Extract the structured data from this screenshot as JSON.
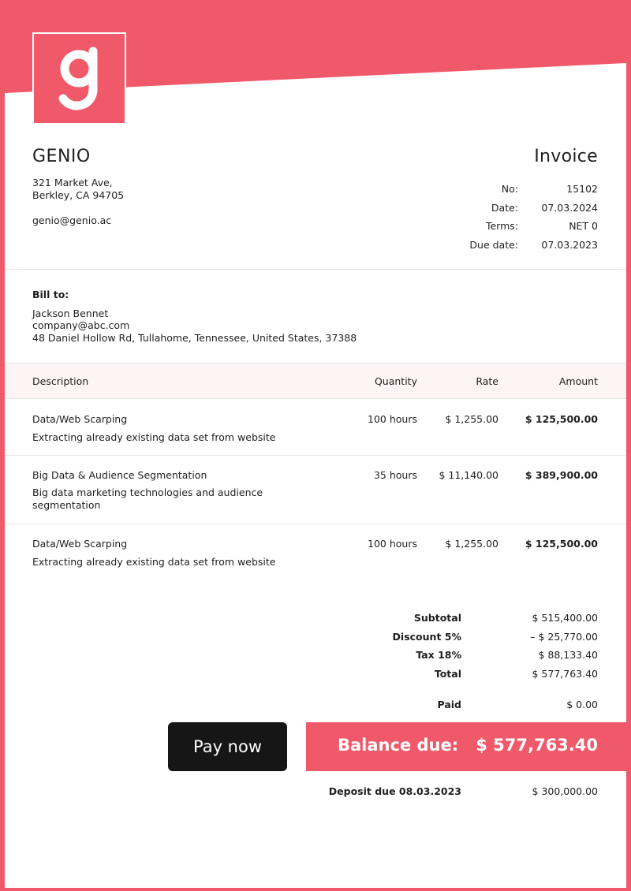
{
  "brand": {
    "accent_color": "#f0596a",
    "logo_letter": "g"
  },
  "company": {
    "name": "GENIO",
    "address_line1": "321 Market Ave,",
    "address_line2": "Berkley, CA 94705",
    "email": "genio@genio.ac"
  },
  "invoice": {
    "title": "Invoice",
    "meta": [
      {
        "label": "No:",
        "value": "15102"
      },
      {
        "label": "Date:",
        "value": "07.03.2024"
      },
      {
        "label": "Terms:",
        "value": "NET 0"
      },
      {
        "label": "Due date:",
        "value": "07.03.2023"
      }
    ]
  },
  "bill_to": {
    "label": "Bill to:",
    "name": "Jackson Bennet",
    "email": "company@abc.com",
    "address": "48 Daniel Hollow Rd, Tullahome, Tennessee, United States, 37388"
  },
  "table": {
    "headers": {
      "description": "Description",
      "quantity": "Quantity",
      "rate": "Rate",
      "amount": "Amount"
    },
    "rows": [
      {
        "title": "Data/Web Scarping",
        "detail": "Extracting already existing data set from website",
        "quantity": "100 hours",
        "rate": "$ 1,255.00",
        "amount": "$ 125,500.00"
      },
      {
        "title": "Big Data & Audience Segmentation",
        "detail": "Big data marketing technologies and audience segmentation",
        "quantity": "35 hours",
        "rate": "$ 11,140.00",
        "amount": "$ 389,900.00"
      },
      {
        "title": "Data/Web Scarping",
        "detail": "Extracting already existing data set from website",
        "quantity": "100 hours",
        "rate": "$ 1,255.00",
        "amount": "$ 125,500.00"
      }
    ]
  },
  "totals": {
    "subtotal_label": "Subtotal",
    "subtotal": "$ 515,400.00",
    "discount_label": "Discount 5%",
    "discount": "– $ 25,770.00",
    "tax_label": "Tax 18%",
    "tax": "$ 88,133.40",
    "total_label": "Total",
    "total": "$ 577,763.40",
    "paid_label": "Paid",
    "paid": "$ 0.00"
  },
  "actions": {
    "pay_now": "Pay now"
  },
  "balance": {
    "label": "Balance due:",
    "value": "$ 577,763.40"
  },
  "deposit": {
    "label": "Deposit due 08.03.2023",
    "value": "$ 300,000.00"
  }
}
